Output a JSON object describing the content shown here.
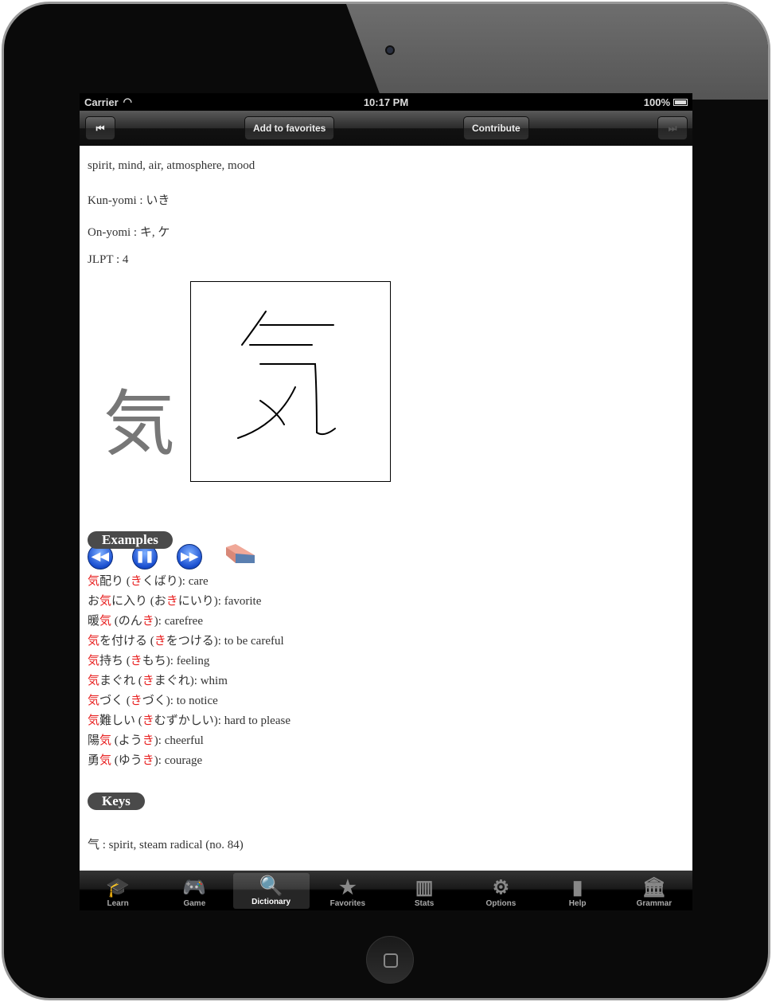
{
  "status": {
    "carrier": "Carrier",
    "time": "10:17 PM",
    "battery": "100%"
  },
  "toolbar": {
    "add_favorites": "Add to favorites",
    "contribute": "Contribute",
    "prev_icon": "skip-back-icon",
    "next_icon": "skip-forward-icon"
  },
  "entry": {
    "meaning": "spirit, mind, air, atmosphere, mood",
    "kun": "Kun-yomi : いき",
    "on": "On-yomi : キ, ケ",
    "jlpt": "JLPT : 4",
    "kanji": "気"
  },
  "examples_label": "Examples",
  "examples": [
    [
      [
        "気",
        1
      ],
      [
        "配り (",
        0
      ],
      [
        "き",
        1
      ],
      [
        "くばり): care",
        0
      ]
    ],
    [
      [
        "お",
        0
      ],
      [
        "気",
        1
      ],
      [
        "に入り (お",
        0
      ],
      [
        "き",
        1
      ],
      [
        "にいり): favorite",
        0
      ]
    ],
    [
      [
        "暖",
        0
      ],
      [
        "気",
        1
      ],
      [
        " (のん",
        0
      ],
      [
        "き",
        1
      ],
      [
        "): carefree",
        0
      ]
    ],
    [
      [
        "気",
        1
      ],
      [
        "を付ける (",
        0
      ],
      [
        "き",
        1
      ],
      [
        "をつける): to be careful",
        0
      ]
    ],
    [
      [
        "気",
        1
      ],
      [
        "持ち (",
        0
      ],
      [
        "き",
        1
      ],
      [
        "もち): feeling",
        0
      ]
    ],
    [
      [
        "気",
        1
      ],
      [
        "まぐれ (",
        0
      ],
      [
        "き",
        1
      ],
      [
        "まぐれ): whim",
        0
      ]
    ],
    [
      [
        "気",
        1
      ],
      [
        "づく (",
        0
      ],
      [
        "き",
        1
      ],
      [
        "づく): to notice",
        0
      ]
    ],
    [
      [
        "気",
        1
      ],
      [
        "難しい (",
        0
      ],
      [
        "き",
        1
      ],
      [
        "むずかしい): hard to please",
        0
      ]
    ],
    [
      [
        "陽",
        0
      ],
      [
        "気",
        1
      ],
      [
        " (よう",
        0
      ],
      [
        "き",
        1
      ],
      [
        "): cheerful",
        0
      ]
    ],
    [
      [
        "勇",
        0
      ],
      [
        "気",
        1
      ],
      [
        " (ゆう",
        0
      ],
      [
        "き",
        1
      ],
      [
        "): courage",
        0
      ]
    ]
  ],
  "keys_label": "Keys",
  "keys": "气 : spirit, steam radical (no. 84)",
  "tabs": [
    {
      "label": "Learn",
      "icon": "graduation-cap-icon",
      "glyph": "🎓"
    },
    {
      "label": "Game",
      "icon": "gamepad-icon",
      "glyph": "🎮"
    },
    {
      "label": "Dictionary",
      "icon": "search-icon",
      "glyph": "🔍"
    },
    {
      "label": "Favorites",
      "icon": "star-icon",
      "glyph": "★"
    },
    {
      "label": "Stats",
      "icon": "bar-chart-icon",
      "glyph": "▥"
    },
    {
      "label": "Options",
      "icon": "gear-icon",
      "glyph": "⚙"
    },
    {
      "label": "Help",
      "icon": "book-icon",
      "glyph": "▮"
    },
    {
      "label": "Grammar",
      "icon": "bank-icon",
      "glyph": "🏛"
    }
  ],
  "active_tab": "Dictionary",
  "colors": {
    "highlight": "#e82020",
    "active_tab_icon": "#3fa0f0"
  }
}
